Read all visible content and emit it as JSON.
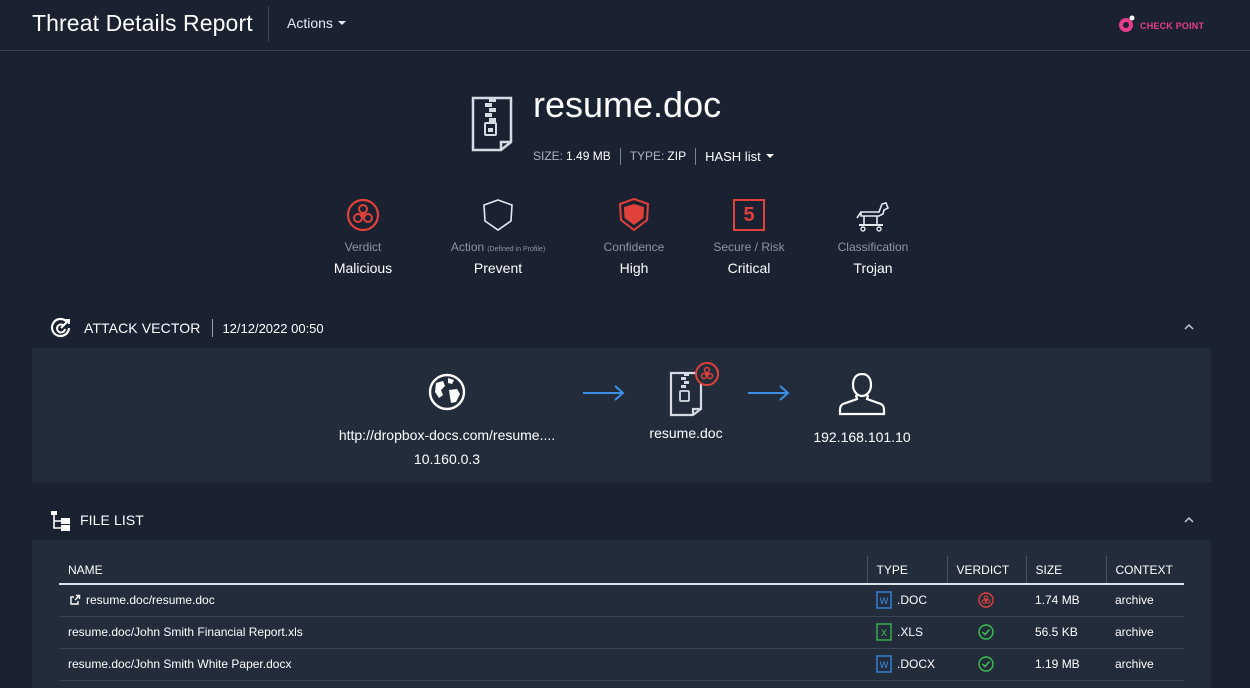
{
  "header": {
    "title": "Threat Details Report",
    "actions_label": "Actions",
    "brand": "CHECK POINT"
  },
  "file": {
    "name": "resume.doc",
    "size_label": "SIZE:",
    "size_value": "1.49 MB",
    "type_label": "TYPE:",
    "type_value": "ZIP",
    "hash_label": "HASH list"
  },
  "summary": [
    {
      "label": "Verdict",
      "note": "",
      "value": "Malicious",
      "icon": "biohazard-icon"
    },
    {
      "label": "Action",
      "note": "(Defined in Profile)",
      "value": "Prevent",
      "icon": "shield-outline-icon"
    },
    {
      "label": "Confidence",
      "note": "",
      "value": "High",
      "icon": "shield-filled-icon"
    },
    {
      "label": "Secure / Risk",
      "note": "",
      "value": "Critical",
      "icon": "risk-score-icon",
      "score": "5"
    },
    {
      "label": "Classification",
      "note": "",
      "value": "Trojan",
      "icon": "trojan-horse-icon"
    }
  ],
  "attack_vector": {
    "title": "ATTACK VECTOR",
    "date": "12/12/2022 00:50",
    "source_url": "http://dropbox-docs.com/resume....",
    "source_ip": "10.160.0.3",
    "file_name": "resume.doc",
    "target_ip": "192.168.101.10"
  },
  "file_list": {
    "title": "FILE LIST",
    "columns": [
      "NAME",
      "TYPE",
      "VERDICT",
      "SIZE",
      "CONTEXT"
    ],
    "rows": [
      {
        "name": "resume.doc/resume.doc",
        "type": ".DOC",
        "type_icon": "word-icon",
        "verdict": "malicious",
        "size": "1.74 MB",
        "context": "archive",
        "external": true
      },
      {
        "name": "resume.doc/John Smith Financial Report.xls",
        "type": ".XLS",
        "type_icon": "excel-icon",
        "verdict": "benign",
        "size": "56.5 KB",
        "context": "archive",
        "external": false
      },
      {
        "name": "resume.doc/John Smith White Paper.docx",
        "type": ".DOCX",
        "type_icon": "word-icon",
        "verdict": "benign",
        "size": "1.19 MB",
        "context": "archive",
        "external": false
      }
    ]
  },
  "colors": {
    "background": "#1a2131",
    "panel": "#232c3b",
    "danger": "#e0413a",
    "success": "#3cbf4f",
    "link_arrow": "#3b8fe6",
    "brand": "#e63c8c"
  }
}
